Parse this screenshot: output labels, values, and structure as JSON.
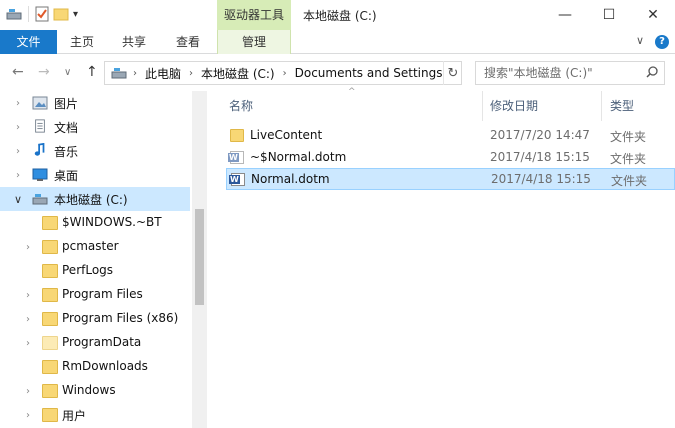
{
  "window": {
    "title": "本地磁盘 (C:)",
    "context_tab": "驱动器工具",
    "minimize": "—",
    "maximize": "☐",
    "close": "✕"
  },
  "ribbon": {
    "file": "文件",
    "tabs": [
      "主页",
      "共享",
      "查看",
      "管理"
    ],
    "help": "?",
    "collapse": "∨"
  },
  "address": {
    "crumbs": [
      "此电脑",
      "本地磁盘 (C:)",
      "Documents and Settings"
    ],
    "refresh": "↻",
    "search_placeholder": "搜索\"本地磁盘 (C:)\""
  },
  "nav": {
    "back": "←",
    "forward": "→",
    "recent": "∨",
    "up": "↑"
  },
  "sidebar": {
    "items": [
      {
        "label": "图片",
        "icon": "pictures-icon",
        "expandable": true
      },
      {
        "label": "文档",
        "icon": "documents-icon",
        "expandable": true
      },
      {
        "label": "音乐",
        "icon": "music-icon",
        "expandable": true
      },
      {
        "label": "桌面",
        "icon": "desktop-icon",
        "expandable": true
      },
      {
        "label": "本地磁盘 (C:)",
        "icon": "drive-icon",
        "expandable": true,
        "expanded": true,
        "selected": true
      },
      {
        "label": "$WINDOWS.~BT",
        "icon": "folder-icon",
        "expandable": false
      },
      {
        "label": "pcmaster",
        "icon": "folder-icon",
        "expandable": true
      },
      {
        "label": "PerfLogs",
        "icon": "folder-icon",
        "expandable": false
      },
      {
        "label": "Program Files",
        "icon": "folder-icon",
        "expandable": true
      },
      {
        "label": "Program Files (x86)",
        "icon": "folder-icon",
        "expandable": true
      },
      {
        "label": "ProgramData",
        "icon": "folder-icon",
        "expandable": true
      },
      {
        "label": "RmDownloads",
        "icon": "folder-icon",
        "expandable": false
      },
      {
        "label": "Windows",
        "icon": "folder-icon",
        "expandable": true
      },
      {
        "label": "用户",
        "icon": "folder-icon",
        "expandable": true
      }
    ]
  },
  "columns": {
    "name": "名称",
    "date": "修改日期",
    "type": "类型"
  },
  "files": [
    {
      "name": "LiveContent",
      "date": "2017/7/20 14:47",
      "type": "文件夹",
      "icon": "folder-icon"
    },
    {
      "name": "~$Normal.dotm",
      "date": "2017/4/18 15:15",
      "type": "文件夹",
      "icon": "word-template-icon"
    },
    {
      "name": "Normal.dotm",
      "date": "2017/4/18 15:15",
      "type": "文件夹",
      "icon": "word-template-icon",
      "selected": true
    }
  ],
  "colors": {
    "accent": "#1979ca",
    "selection": "#cce8ff",
    "context_tab": "#d7ecb7"
  }
}
